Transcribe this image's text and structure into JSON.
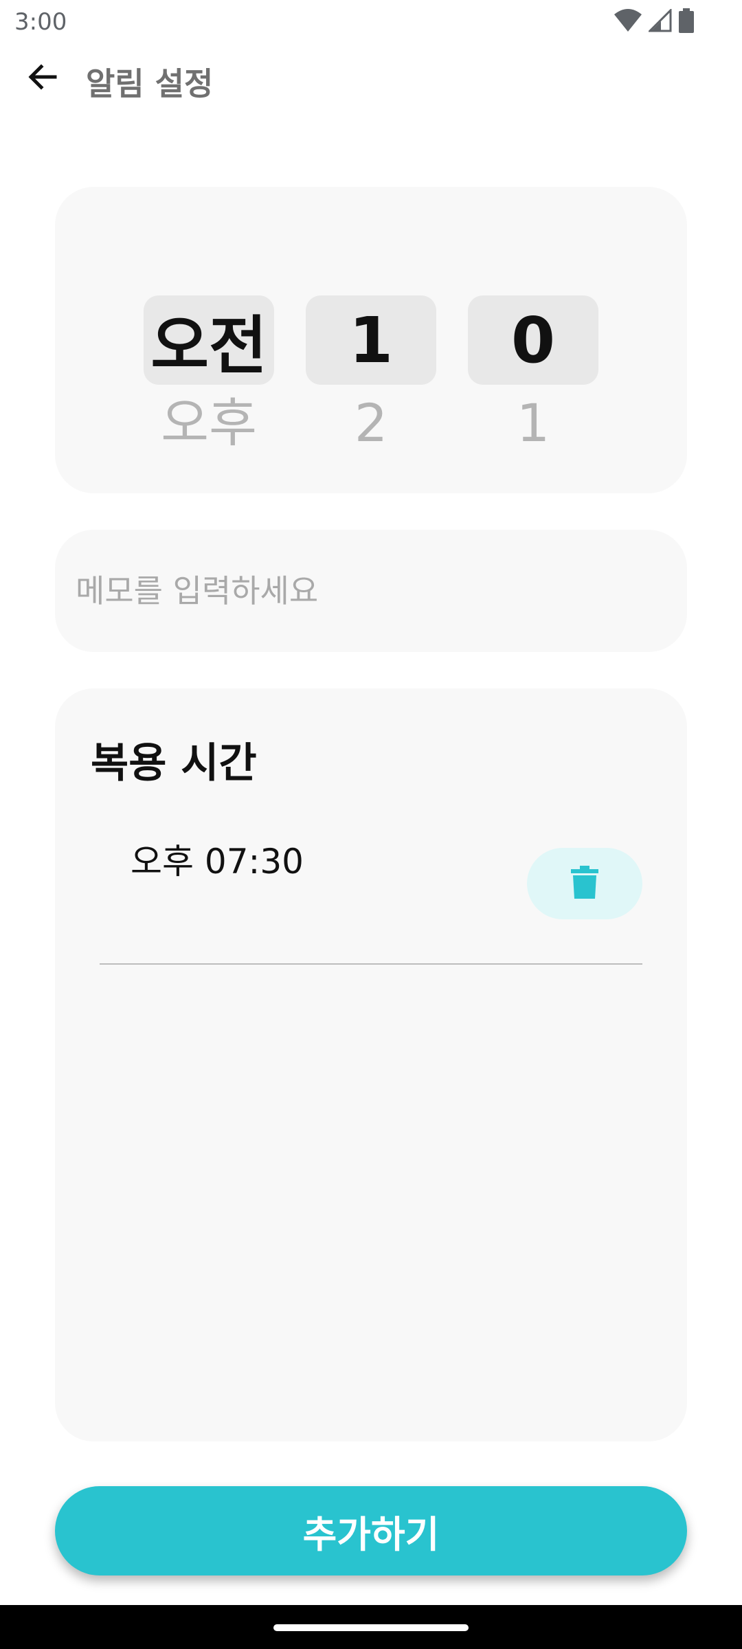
{
  "status_bar": {
    "time": "3:00",
    "icons": [
      "wifi-icon",
      "signal-icon",
      "battery-icon"
    ]
  },
  "app_bar": {
    "back_icon": "arrow-left-icon",
    "title": "알림 설정"
  },
  "time_picker": {
    "ampm": {
      "selected": "오전",
      "next": "오후"
    },
    "hour": {
      "selected": "1",
      "next": "2"
    },
    "minute": {
      "selected": "0",
      "next": "1"
    }
  },
  "memo": {
    "placeholder": "메모를 입력하세요",
    "value": ""
  },
  "dose_times": {
    "title": "복용 시간",
    "items": [
      {
        "time": "오후 07:30",
        "delete_icon": "trash-icon"
      }
    ]
  },
  "add_button": {
    "label": "추가하기"
  },
  "colors": {
    "accent": "#29c3cf",
    "delete_bg": "#e0f7f8",
    "card_bg": "#f8f8f8",
    "picker_highlight": "#e8e8e8"
  }
}
